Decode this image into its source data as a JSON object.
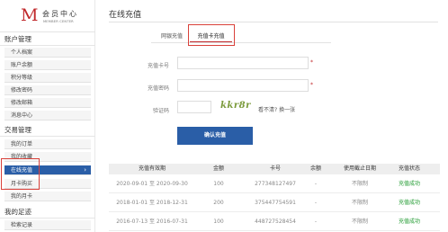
{
  "logo": {
    "letter": "M",
    "title_cn": "会员中心",
    "title_en": "MEMBER CENTER"
  },
  "sidebar": {
    "sections": [
      {
        "title": "账户管理",
        "items": [
          "个人档案",
          "账户余额",
          "积分等级",
          "修改密码",
          "修改邮箱",
          "消息中心"
        ]
      },
      {
        "title": "交易管理",
        "items": [
          "我的订单",
          "我的收藏",
          "在线充值",
          "月卡购买",
          "我的月卡"
        ]
      },
      {
        "title": "我的足迹",
        "items": [
          "检索记录"
        ]
      }
    ],
    "active_item": "在线充值",
    "active_arrow": "›"
  },
  "page": {
    "title": "在线充值"
  },
  "tabs": [
    {
      "label": "网银充值"
    },
    {
      "label": "充值卡充值"
    }
  ],
  "form": {
    "card_no_label": "充值卡号",
    "card_pwd_label": "充值密码",
    "captcha_label": "验证码",
    "required_mark": "*",
    "captcha_text": "kkr8r",
    "refresh_text": "看不清? 换一张",
    "submit_label": "确认充值"
  },
  "table": {
    "headers": [
      "充值有效期",
      "金额",
      "卡号",
      "余额",
      "使用截止日期",
      "充值状态"
    ],
    "rows": [
      [
        "2020-09-01 至 2020-09-30",
        "100",
        "277348127497",
        "-",
        "不限制",
        "充值成功"
      ],
      [
        "2018-01-01 至 2018-12-31",
        "200",
        "375447754591",
        "-",
        "不限制",
        "充值成功"
      ],
      [
        "2016-07-13 至 2016-07-31",
        "100",
        "448727528454",
        "-",
        "不限制",
        "充值成功"
      ]
    ]
  },
  "colors": {
    "brand": "#c0282b",
    "active": "#2a5ea7",
    "success": "#1f9a2f",
    "highlight": "#d9413a"
  }
}
